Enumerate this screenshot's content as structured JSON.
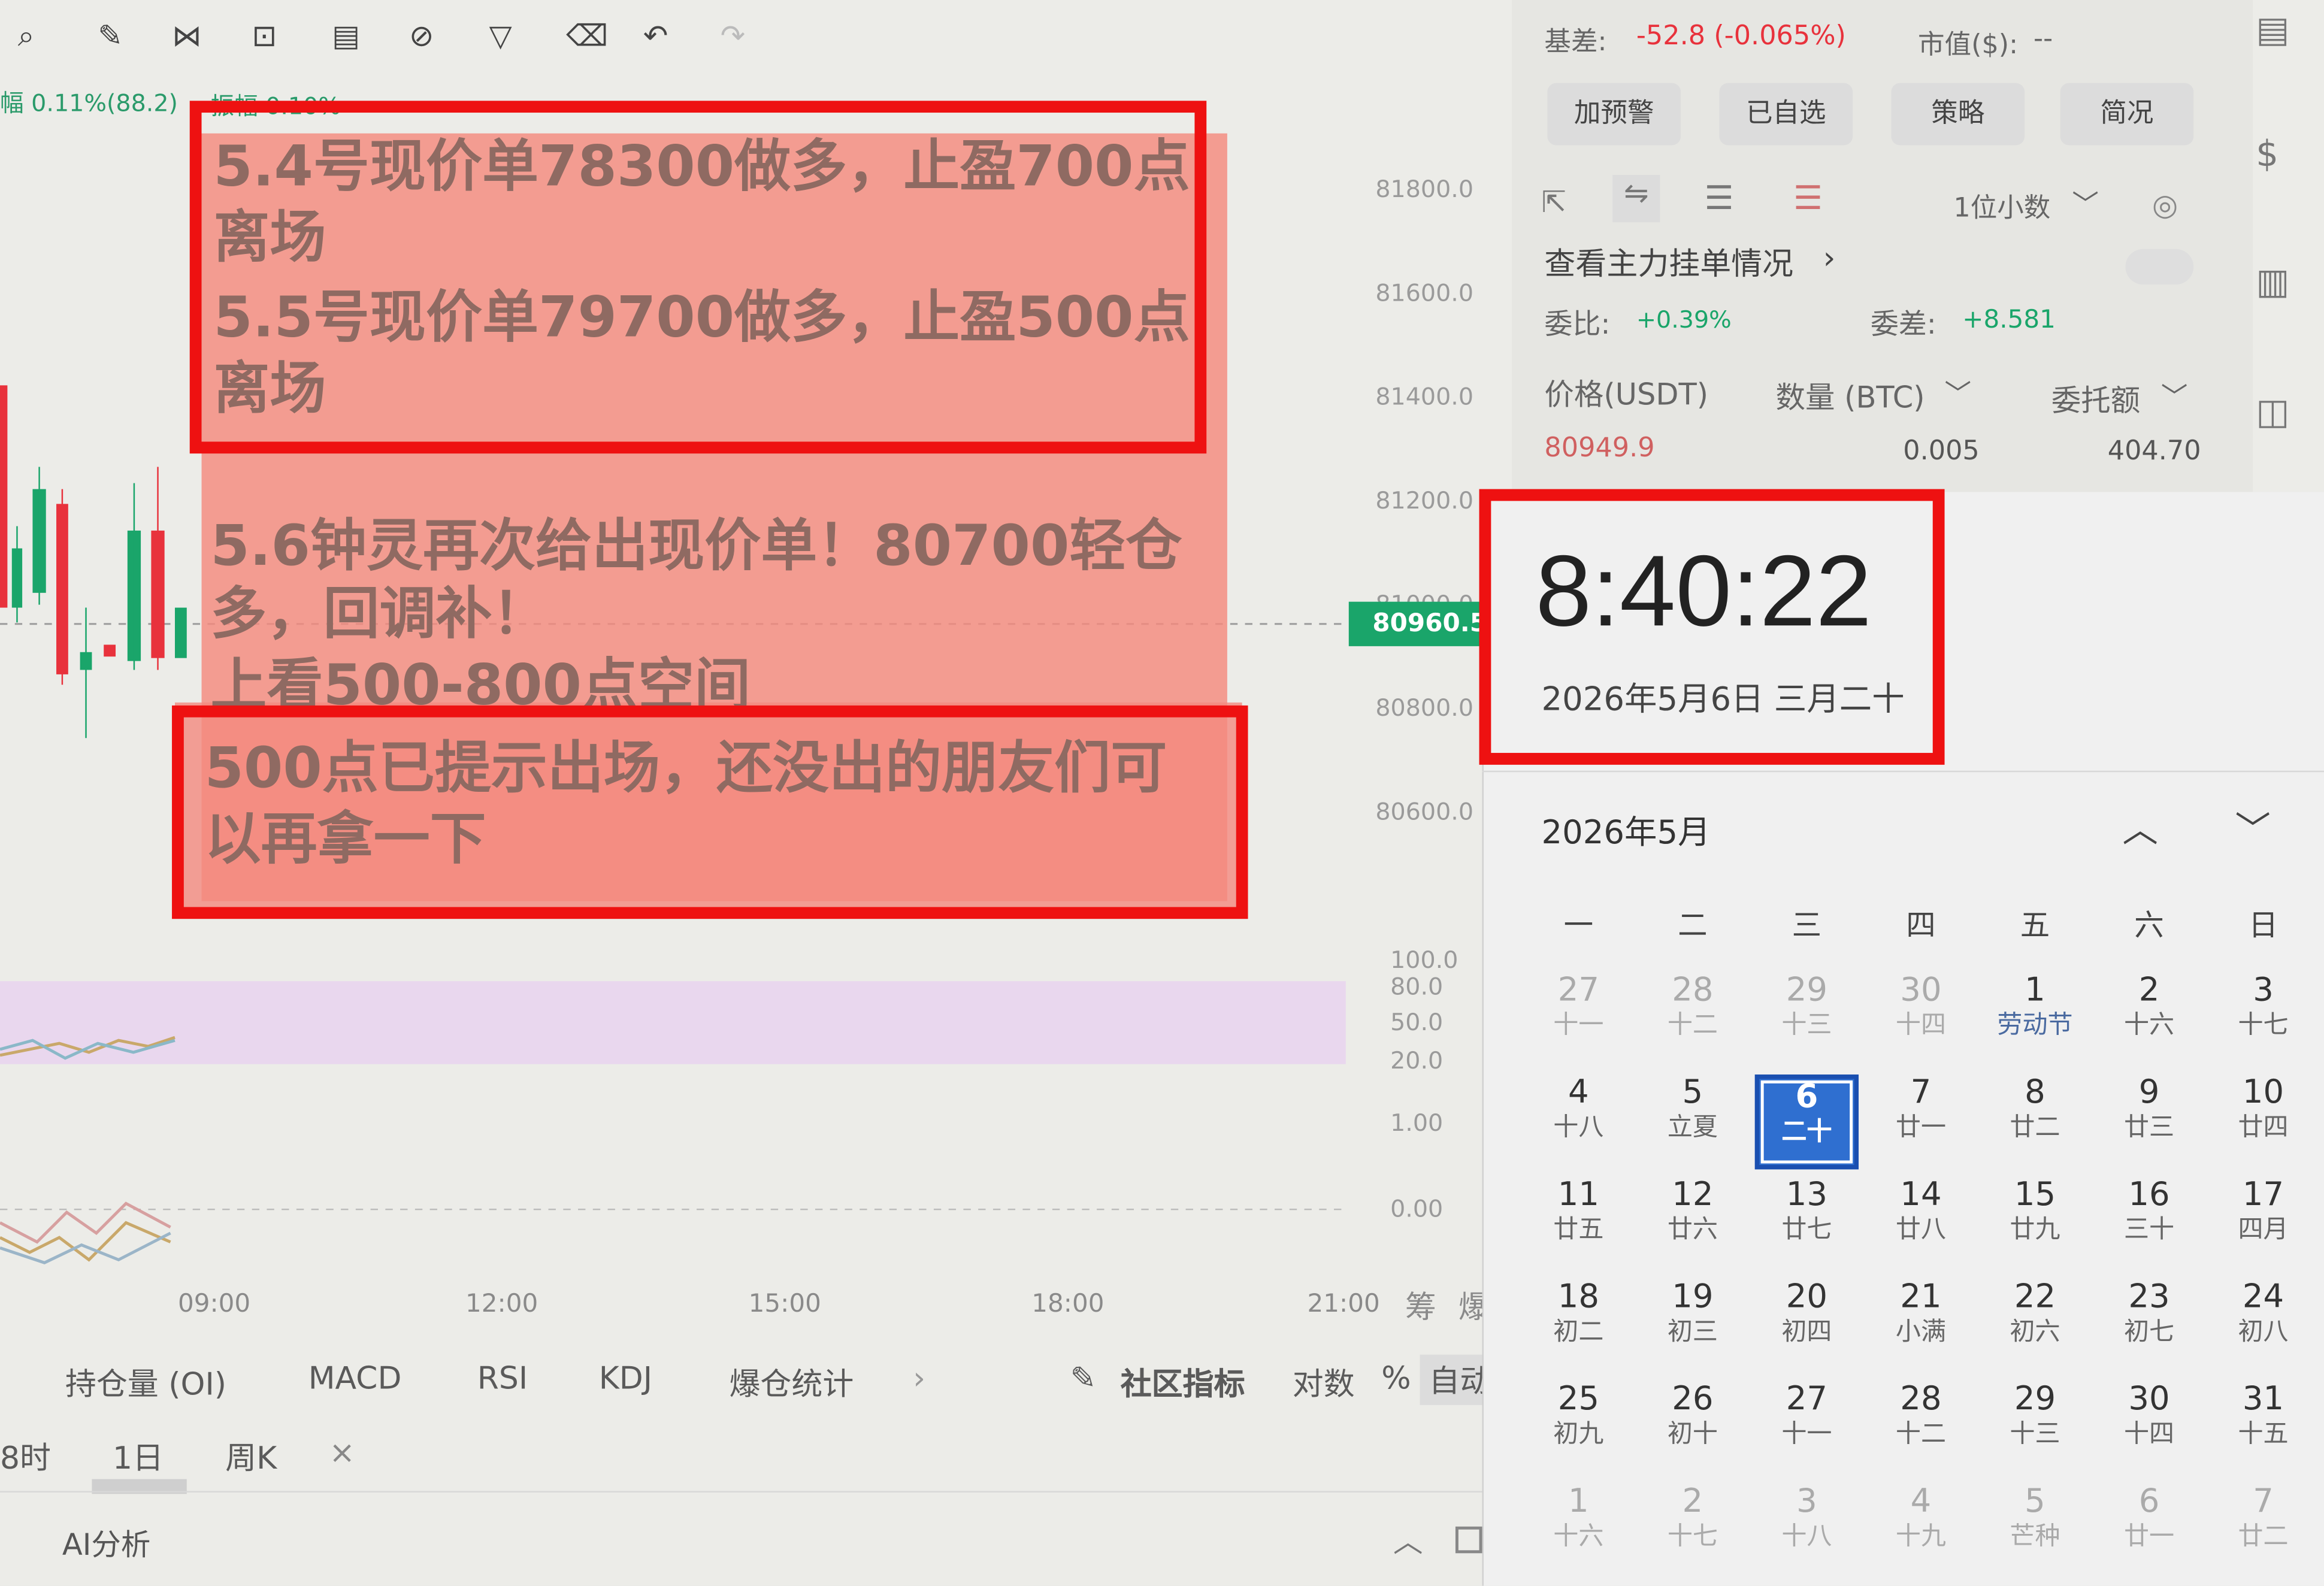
{
  "toolbar": {
    "icons": [
      "zoom-icon",
      "pen-icon",
      "measure-icon",
      "lock-icon",
      "note-icon",
      "magnet-icon",
      "filter-icon",
      "delete-icon",
      "undo-icon",
      "redo-icon"
    ]
  },
  "chart_header": {
    "stat": "幅 0.11%(88.2)",
    "amp": "振幅 0.10%"
  },
  "notes": {
    "box1": [
      "5.4号现价单78300做多，止盈700点",
      "离场",
      "5.5号现价单79700做多，止盈500点",
      "离场"
    ],
    "middle": [
      "5.6钟灵再次给出现价单！80700轻仓",
      "多，回调补！",
      "上看500-800点空间"
    ],
    "box2": [
      "500点已提示出场，还没出的朋友们可",
      "以再拿一下"
    ]
  },
  "price_axis": [
    "81800.0",
    "81600.0",
    "81400.0",
    "81200.0",
    "81000.0",
    "80800.0",
    "80600.0"
  ],
  "current_price": "80960.5",
  "indicator_axis": [
    "100.0",
    "80.0",
    "50.0",
    "20.0",
    "1.00",
    "0.00"
  ],
  "time_axis": [
    "09:00",
    "12:00",
    "15:00",
    "18:00",
    "21:00"
  ],
  "time_axis_extra": [
    "筹",
    "爆"
  ],
  "indicator_tabs": [
    "持仓量 (OI)",
    "MACD",
    "RSI",
    "KDJ",
    "爆仓统计"
  ],
  "community": "社区指标",
  "scale_opts": [
    "对数",
    "%",
    "自动"
  ],
  "periods": [
    "8时",
    "1日",
    "周K",
    "×"
  ],
  "ai_panel": "AI分析",
  "market": {
    "basis_label": "基差:",
    "basis_value": "-52.8 (-0.065%)",
    "mcap_label": "市值($):",
    "mcap_value": "--",
    "buttons": [
      "加预警",
      "已自选",
      "策略",
      "简况"
    ],
    "decimals": "1位小数",
    "main_orders": "查看主力挂单情况",
    "ratio_label": "委比:",
    "ratio_value": "+0.39%",
    "diff_label": "委差:",
    "diff_value": "+8.581",
    "col_price": "价格(USDT)",
    "col_qty": "数量 (BTC)",
    "col_amount": "委托额",
    "row": {
      "price": "80949.9",
      "qty": "0.005",
      "amount": "404.70"
    }
  },
  "clock": {
    "time": "8:40:22",
    "date": "2026年5月6日 三月二十"
  },
  "calendar": {
    "month": "2026年5月",
    "weekdays": [
      "一",
      "二",
      "三",
      "四",
      "五",
      "六",
      "日"
    ],
    "weeks": [
      [
        {
          "d": "27",
          "l": "十一",
          "m": true
        },
        {
          "d": "28",
          "l": "十二",
          "m": true
        },
        {
          "d": "29",
          "l": "十三",
          "m": true
        },
        {
          "d": "30",
          "l": "十四",
          "m": true
        },
        {
          "d": "1",
          "l": "劳动节",
          "f": true
        },
        {
          "d": "2",
          "l": "十六"
        },
        {
          "d": "3",
          "l": "十七"
        }
      ],
      [
        {
          "d": "4",
          "l": "十八"
        },
        {
          "d": "5",
          "l": "立夏"
        },
        {
          "d": "6",
          "l": "二十",
          "t": true
        },
        {
          "d": "7",
          "l": "廿一"
        },
        {
          "d": "8",
          "l": "廿二"
        },
        {
          "d": "9",
          "l": "廿三"
        },
        {
          "d": "10",
          "l": "廿四"
        }
      ],
      [
        {
          "d": "11",
          "l": "廿五"
        },
        {
          "d": "12",
          "l": "廿六"
        },
        {
          "d": "13",
          "l": "廿七"
        },
        {
          "d": "14",
          "l": "廿八"
        },
        {
          "d": "15",
          "l": "廿九"
        },
        {
          "d": "16",
          "l": "三十"
        },
        {
          "d": "17",
          "l": "四月"
        }
      ],
      [
        {
          "d": "18",
          "l": "初二"
        },
        {
          "d": "19",
          "l": "初三"
        },
        {
          "d": "20",
          "l": "初四"
        },
        {
          "d": "21",
          "l": "小满"
        },
        {
          "d": "22",
          "l": "初六"
        },
        {
          "d": "23",
          "l": "初七"
        },
        {
          "d": "24",
          "l": "初八"
        }
      ],
      [
        {
          "d": "25",
          "l": "初九"
        },
        {
          "d": "26",
          "l": "初十"
        },
        {
          "d": "27",
          "l": "十一"
        },
        {
          "d": "28",
          "l": "十二"
        },
        {
          "d": "29",
          "l": "十三"
        },
        {
          "d": "30",
          "l": "十四"
        },
        {
          "d": "31",
          "l": "十五"
        }
      ],
      [
        {
          "d": "1",
          "l": "十六",
          "m": true
        },
        {
          "d": "2",
          "l": "十七",
          "m": true
        },
        {
          "d": "3",
          "l": "十八",
          "m": true
        },
        {
          "d": "4",
          "l": "十九",
          "m": true
        },
        {
          "d": "5",
          "l": "芒种",
          "m": true
        },
        {
          "d": "6",
          "l": "廿一",
          "m": true
        },
        {
          "d": "7",
          "l": "廿二",
          "m": true
        }
      ]
    ]
  },
  "colors": {
    "up": "#1aa56a",
    "down": "#e8323c",
    "highlight": "#f48a7e",
    "box": "#ee1111",
    "today": "#2f6fd0"
  }
}
